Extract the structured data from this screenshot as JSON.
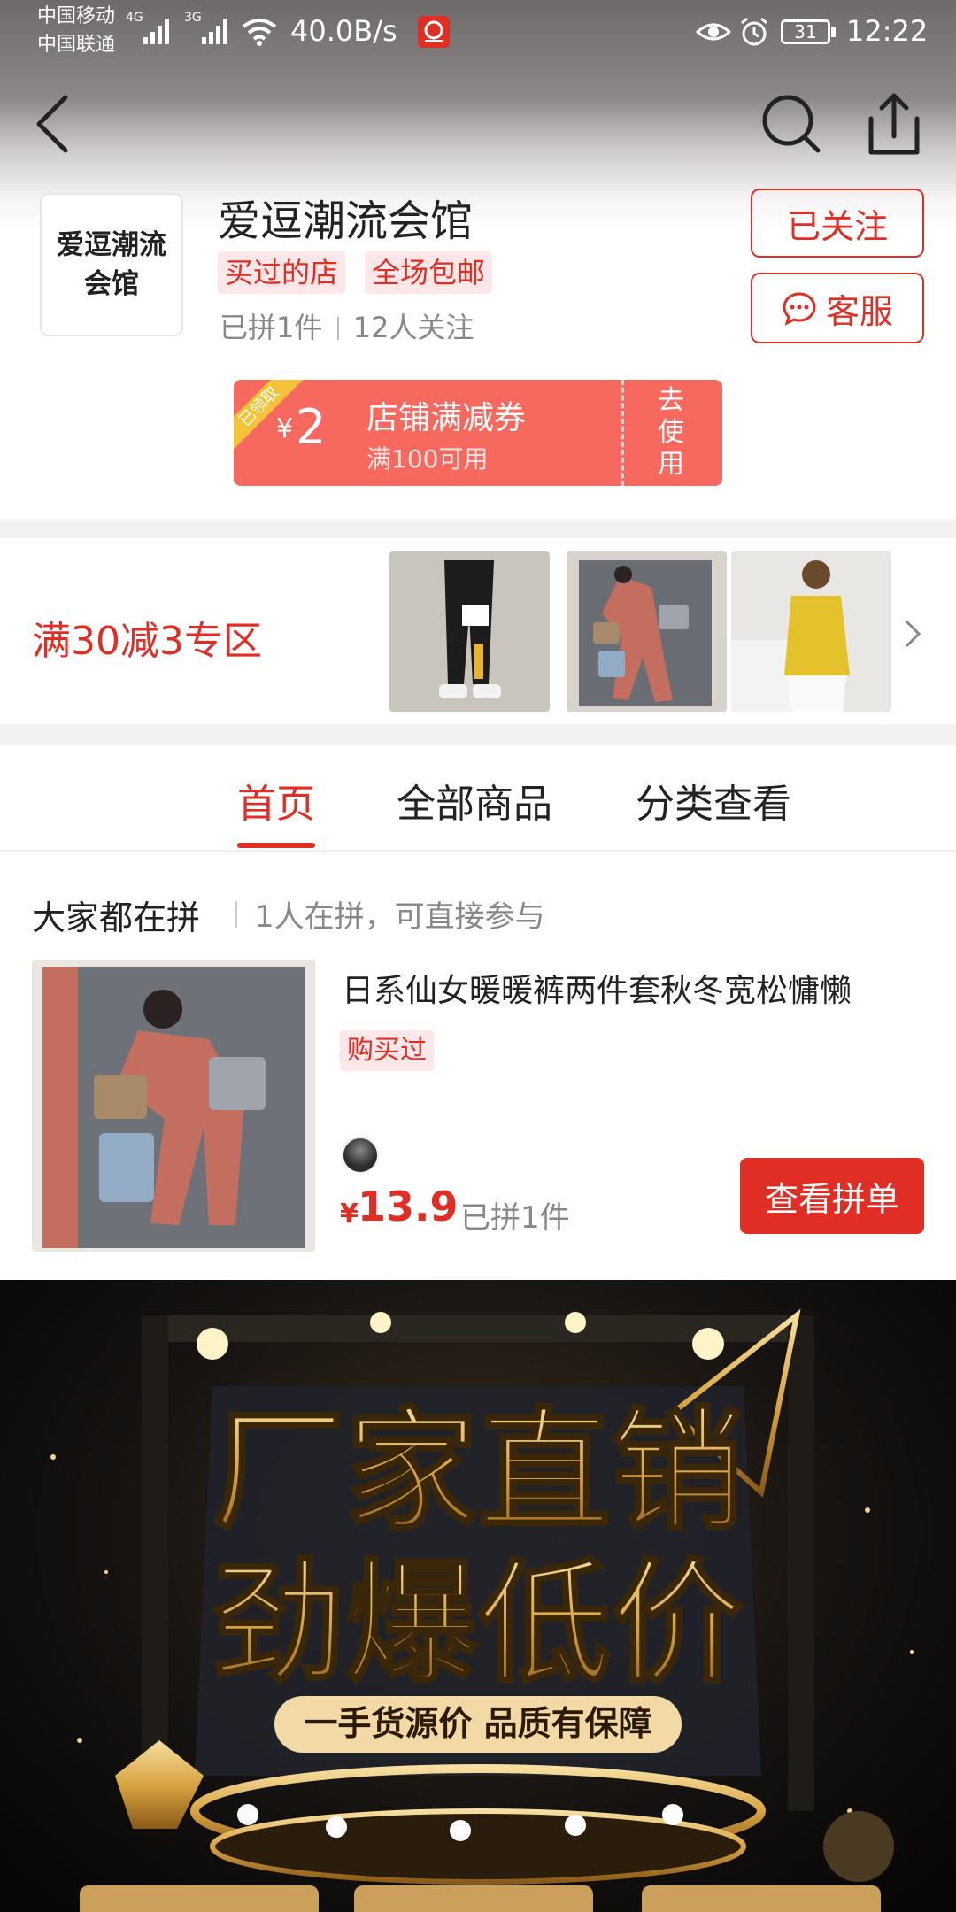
{
  "status_bar": {
    "carrier1": "中国移动",
    "carrier2": "中国联通",
    "net1": "4G",
    "net2": "3G",
    "speed": "40.0B/s",
    "battery": "31",
    "time": "12:22"
  },
  "nav": {
    "back_icon": "chevron-left-icon",
    "search_icon": "search-icon",
    "share_icon": "share-icon"
  },
  "shop": {
    "logo_text": "爱逗潮流会馆",
    "name": "爱逗潮流会馆",
    "tags": [
      "买过的店",
      "全场包邮"
    ],
    "stats_left": "已拼1件",
    "stats_right": "12人关注",
    "follow_label": "已关注",
    "service_label": "客服"
  },
  "coupon": {
    "ribbon": "已领取",
    "currency": "¥",
    "amount": "2",
    "title": "店铺满减券",
    "condition": "满100可用",
    "action": "去使用"
  },
  "promo": {
    "title": "满30减3专区"
  },
  "tabs": [
    {
      "label": "首页",
      "active": true
    },
    {
      "label": "全部商品",
      "active": false
    },
    {
      "label": "分类查看",
      "active": false
    }
  ],
  "group_buy": {
    "heading": "大家都在拼",
    "subheading": "1人在拼，可直接参与",
    "product_title": "日系仙女暖暖裤两件套秋冬宽松慵懒",
    "badge": "购买过",
    "currency": "¥",
    "price": "13.9",
    "sold": "已拼1件",
    "button": "查看拼单"
  },
  "banner": {
    "headline1": "厂家直销",
    "headline2": "劲爆低价",
    "tagline": "一手货源价 品质有保障"
  },
  "colors": {
    "brand_red": "#e02e24",
    "coupon": "#f7695f",
    "tag_bg": "#fde7e8",
    "gold": "#d9a441"
  }
}
